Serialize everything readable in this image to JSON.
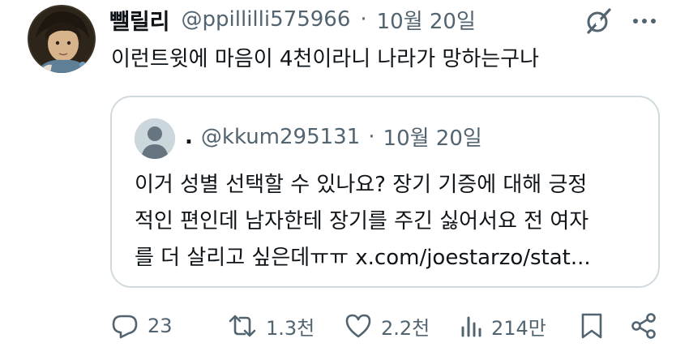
{
  "tweet": {
    "display_name": "뺄릴리",
    "handle": "@ppillilli575966",
    "separator": "·",
    "date": "10월 20일",
    "text": "이런트윗에 마음이 4천이라니 나라가 망하는구나"
  },
  "quote": {
    "display_name": ".",
    "handle": "@kkum295131",
    "separator": "·",
    "date": "10월 20일",
    "lines": [
      "이거 성별 선택할 수 있나요? 장기 기증에 대해 긍정",
      "적인 편인데 남자한테 장기를 주긴 싫어서요 전 여자",
      "를 더 살리고 싶은데ㅠㅠ x.com/joestarzo/stat..."
    ]
  },
  "actions": {
    "replies": "23",
    "retweets": "1.3천",
    "likes": "2.2천",
    "views": "214만"
  },
  "icons": {
    "grok": "grok-icon",
    "more": "more-dots-icon",
    "reply": "reply-icon",
    "retweet": "retweet-icon",
    "like": "heart-icon",
    "views": "views-chart-icon",
    "bookmark": "bookmark-icon",
    "share": "share-icon"
  },
  "colors": {
    "text": "#0f1419",
    "muted": "#536471",
    "border": "#cfd9de"
  }
}
